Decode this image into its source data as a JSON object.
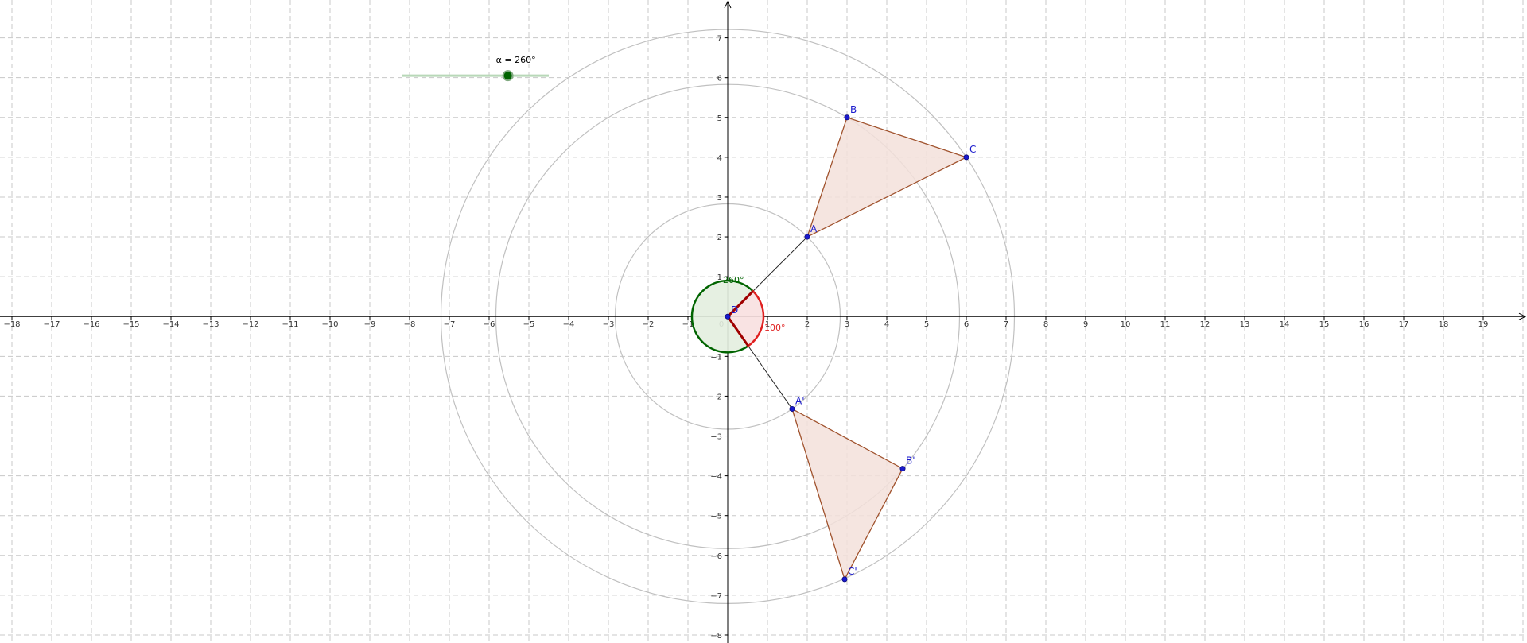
{
  "view": {
    "x_range": [
      -18.3,
      20.1
    ],
    "y_range": [
      -8.2,
      7.95
    ],
    "grid": true,
    "grid_style": "dashed",
    "x_ticks": [
      -18,
      -17,
      -16,
      -15,
      -14,
      -13,
      -12,
      -11,
      -10,
      -9,
      -8,
      -7,
      -6,
      -5,
      -4,
      -3,
      -2,
      -1,
      0,
      1,
      2,
      3,
      4,
      5,
      6,
      7,
      8,
      9,
      10,
      11,
      12,
      13,
      14,
      15,
      16,
      17,
      18,
      19
    ],
    "y_ticks": [
      -8,
      -7,
      -6,
      -5,
      -4,
      -3,
      -2,
      -1,
      1,
      2,
      3,
      4,
      5,
      6,
      7
    ]
  },
  "colors": {
    "axis": "#000000",
    "grid": "#c8c8c8",
    "circle": "#c0c0c0",
    "polygon_stroke": "#a0522d",
    "polygon_fill": "#f3e1db",
    "point": "#1a1acc",
    "angle_green": "#006400",
    "angle_green_fill": "#e3eedf",
    "angle_red": "#e02020",
    "angle_red_fill": "#f8e0e0",
    "slider_track": "#b8d8b8",
    "slider_knob": "#006400"
  },
  "slider": {
    "label": "α = 260°",
    "value_deg": 260,
    "min_deg": 0,
    "max_deg": 360
  },
  "points": {
    "D": {
      "label": "D",
      "x": 0,
      "y": 0
    },
    "A": {
      "label": "A",
      "x": 2,
      "y": 2
    },
    "B": {
      "label": "B",
      "x": 3,
      "y": 5
    },
    "C": {
      "label": "C",
      "x": 6,
      "y": 4
    },
    "A_img": {
      "label": "A'",
      "x": 1.62,
      "y": -2.32
    },
    "B_img": {
      "label": "B'",
      "x": 4.4,
      "y": -3.82
    },
    "C_img": {
      "label": "C'",
      "x": 2.94,
      "y": -6.6
    }
  },
  "circles_radii": [
    2.83,
    5.83,
    7.21
  ],
  "angles": {
    "big": {
      "label": "260°",
      "radius": 0.9
    },
    "small": {
      "label": "100°",
      "radius": 0.9
    }
  }
}
